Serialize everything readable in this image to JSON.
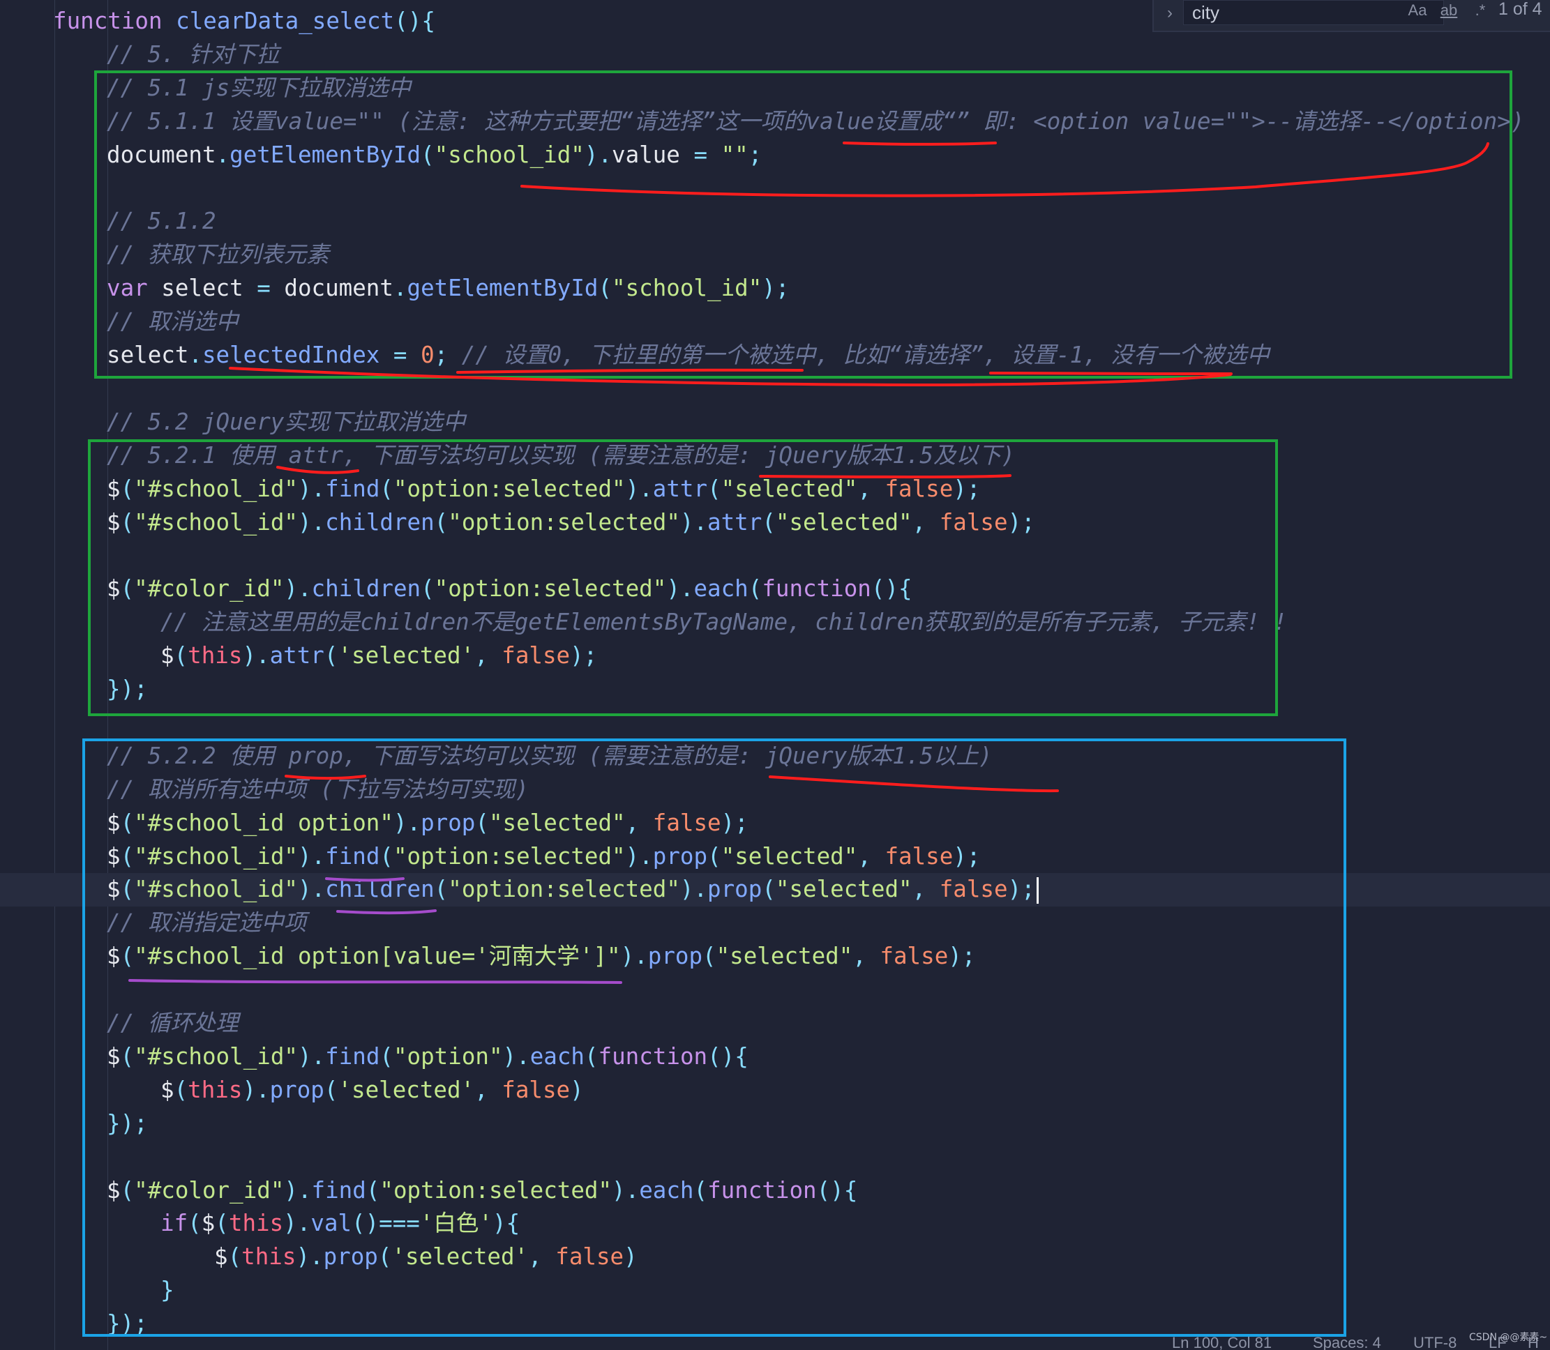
{
  "find_widget": {
    "search_value": "city",
    "match_case_label": "Aa",
    "match_word_label": "ab",
    "regex_label": ".*",
    "match_count": "1 of 4"
  },
  "status_bar": {
    "cursor_position": "Ln 100, Col 81",
    "indentation": "Spaces: 4",
    "encoding": "UTF-8",
    "line_ending": "LF",
    "extra": "H"
  },
  "watermark": "CSDN @@素素~",
  "code": [
    {
      "indent": 0,
      "tokens": [
        [
          "function",
          "keyword"
        ],
        [
          " ",
          "default"
        ],
        [
          "clearData_select",
          "function"
        ],
        [
          "()",
          "punct"
        ],
        [
          "{",
          "punct"
        ]
      ]
    },
    {
      "indent": 1,
      "tokens": [
        [
          "// 5. 针对下拉",
          "comment"
        ]
      ]
    },
    {
      "indent": 1,
      "tokens": [
        [
          "// 5.1 js实现下拉取消选中",
          "comment"
        ]
      ]
    },
    {
      "indent": 1,
      "tokens": [
        [
          "// 5.1.1 设置value=\"\" (注意: 这种方式要把“请选择”这一项的value设置成“” 即: <option value=\"\">--请选择--</option>)",
          "comment"
        ]
      ]
    },
    {
      "indent": 1,
      "tokens": [
        [
          "document",
          "default"
        ],
        [
          ".",
          "punct"
        ],
        [
          "getElementById",
          "function"
        ],
        [
          "(",
          "punct"
        ],
        [
          "\"school_id\"",
          "string"
        ],
        [
          ")",
          "punct"
        ],
        [
          ".",
          "punct"
        ],
        [
          "value",
          "default"
        ],
        [
          " = ",
          "punct"
        ],
        [
          "\"\"",
          "string"
        ],
        [
          ";",
          "punct"
        ]
      ]
    },
    {
      "indent": 1,
      "tokens": []
    },
    {
      "indent": 1,
      "tokens": [
        [
          "// 5.1.2",
          "comment"
        ]
      ]
    },
    {
      "indent": 1,
      "tokens": [
        [
          "// 获取下拉列表元素",
          "comment"
        ]
      ]
    },
    {
      "indent": 1,
      "tokens": [
        [
          "var",
          "keyword"
        ],
        [
          " select ",
          "default"
        ],
        [
          "=",
          "punct"
        ],
        [
          " document",
          "default"
        ],
        [
          ".",
          "punct"
        ],
        [
          "getElementById",
          "function"
        ],
        [
          "(",
          "punct"
        ],
        [
          "\"school_id\"",
          "string"
        ],
        [
          ")",
          "punct"
        ],
        [
          ";",
          "punct"
        ]
      ]
    },
    {
      "indent": 1,
      "tokens": [
        [
          "// 取消选中",
          "comment"
        ]
      ]
    },
    {
      "indent": 1,
      "tokens": [
        [
          "select",
          "default"
        ],
        [
          ".",
          "punct"
        ],
        [
          "selectedIndex",
          "function"
        ],
        [
          " = ",
          "punct"
        ],
        [
          "0",
          "number"
        ],
        [
          ";",
          "punct"
        ],
        [
          " // 设置0, 下拉里的第一个被选中, 比如“请选择”, 设置-1, 没有一个被选中",
          "comment"
        ]
      ]
    },
    {
      "indent": 1,
      "tokens": []
    },
    {
      "indent": 1,
      "tokens": [
        [
          "// 5.2 jQuery实现下拉取消选中",
          "comment"
        ]
      ]
    },
    {
      "indent": 1,
      "tokens": [
        [
          "// 5.2.1 使用 attr, 下面写法均可以实现 (需要注意的是: jQuery版本1.5及以下)",
          "comment"
        ]
      ]
    },
    {
      "indent": 1,
      "tokens": [
        [
          "$",
          "default"
        ],
        [
          "(",
          "punct"
        ],
        [
          "\"#school_id\"",
          "string"
        ],
        [
          ")",
          "punct"
        ],
        [
          ".",
          "punct"
        ],
        [
          "find",
          "function"
        ],
        [
          "(",
          "punct"
        ],
        [
          "\"option:selected\"",
          "string"
        ],
        [
          ")",
          "punct"
        ],
        [
          ".",
          "punct"
        ],
        [
          "attr",
          "function"
        ],
        [
          "(",
          "punct"
        ],
        [
          "\"selected\"",
          "string"
        ],
        [
          ", ",
          "punct"
        ],
        [
          "false",
          "const"
        ],
        [
          ");",
          "punct"
        ]
      ]
    },
    {
      "indent": 1,
      "tokens": [
        [
          "$",
          "default"
        ],
        [
          "(",
          "punct"
        ],
        [
          "\"#school_id\"",
          "string"
        ],
        [
          ")",
          "punct"
        ],
        [
          ".",
          "punct"
        ],
        [
          "children",
          "function"
        ],
        [
          "(",
          "punct"
        ],
        [
          "\"option:selected\"",
          "string"
        ],
        [
          ")",
          "punct"
        ],
        [
          ".",
          "punct"
        ],
        [
          "attr",
          "function"
        ],
        [
          "(",
          "punct"
        ],
        [
          "\"selected\"",
          "string"
        ],
        [
          ", ",
          "punct"
        ],
        [
          "false",
          "const"
        ],
        [
          ");",
          "punct"
        ]
      ]
    },
    {
      "indent": 1,
      "tokens": []
    },
    {
      "indent": 1,
      "tokens": [
        [
          "$",
          "default"
        ],
        [
          "(",
          "punct"
        ],
        [
          "\"#color_id\"",
          "string"
        ],
        [
          ")",
          "punct"
        ],
        [
          ".",
          "punct"
        ],
        [
          "children",
          "function"
        ],
        [
          "(",
          "punct"
        ],
        [
          "\"option:selected\"",
          "string"
        ],
        [
          ")",
          "punct"
        ],
        [
          ".",
          "punct"
        ],
        [
          "each",
          "function"
        ],
        [
          "(",
          "punct"
        ],
        [
          "function",
          "keyword"
        ],
        [
          "(){",
          "punct"
        ]
      ]
    },
    {
      "indent": 2,
      "tokens": [
        [
          "// 注意这里用的是children不是getElementsByTagName, children获取到的是所有子元素, 子元素! !",
          "comment"
        ]
      ]
    },
    {
      "indent": 2,
      "tokens": [
        [
          "$",
          "default"
        ],
        [
          "(",
          "punct"
        ],
        [
          "this",
          "this"
        ],
        [
          ")",
          "punct"
        ],
        [
          ".",
          "punct"
        ],
        [
          "attr",
          "function"
        ],
        [
          "(",
          "punct"
        ],
        [
          "'selected'",
          "string"
        ],
        [
          ", ",
          "punct"
        ],
        [
          "false",
          "const"
        ],
        [
          ");",
          "punct"
        ]
      ]
    },
    {
      "indent": 1,
      "tokens": [
        [
          "});",
          "punct"
        ]
      ]
    },
    {
      "indent": 1,
      "tokens": []
    },
    {
      "indent": 1,
      "tokens": [
        [
          "// 5.2.2 使用 prop, 下面写法均可以实现 (需要注意的是: jQuery版本1.5以上)",
          "comment"
        ]
      ]
    },
    {
      "indent": 1,
      "tokens": [
        [
          "// 取消所有选中项 (下拉写法均可实现)",
          "comment"
        ]
      ]
    },
    {
      "indent": 1,
      "tokens": [
        [
          "$",
          "default"
        ],
        [
          "(",
          "punct"
        ],
        [
          "\"#school_id option\"",
          "string"
        ],
        [
          ")",
          "punct"
        ],
        [
          ".",
          "punct"
        ],
        [
          "prop",
          "function"
        ],
        [
          "(",
          "punct"
        ],
        [
          "\"selected\"",
          "string"
        ],
        [
          ", ",
          "punct"
        ],
        [
          "false",
          "const"
        ],
        [
          ");",
          "punct"
        ]
      ]
    },
    {
      "indent": 1,
      "tokens": [
        [
          "$",
          "default"
        ],
        [
          "(",
          "punct"
        ],
        [
          "\"#school_id\"",
          "string"
        ],
        [
          ")",
          "punct"
        ],
        [
          ".",
          "punct"
        ],
        [
          "find",
          "function"
        ],
        [
          "(",
          "punct"
        ],
        [
          "\"option:selected\"",
          "string"
        ],
        [
          ")",
          "punct"
        ],
        [
          ".",
          "punct"
        ],
        [
          "prop",
          "function"
        ],
        [
          "(",
          "punct"
        ],
        [
          "\"selected\"",
          "string"
        ],
        [
          ", ",
          "punct"
        ],
        [
          "false",
          "const"
        ],
        [
          ");",
          "punct"
        ]
      ]
    },
    {
      "indent": 1,
      "tokens": [
        [
          "$",
          "default"
        ],
        [
          "(",
          "punct"
        ],
        [
          "\"#school_id\"",
          "string"
        ],
        [
          ")",
          "punct"
        ],
        [
          ".",
          "punct"
        ],
        [
          "children",
          "function"
        ],
        [
          "(",
          "punct"
        ],
        [
          "\"option:selected\"",
          "string"
        ],
        [
          ")",
          "punct"
        ],
        [
          ".",
          "punct"
        ],
        [
          "prop",
          "function"
        ],
        [
          "(",
          "punct"
        ],
        [
          "\"selected\"",
          "string"
        ],
        [
          ", ",
          "punct"
        ],
        [
          "false",
          "const"
        ],
        [
          ");",
          "punct"
        ]
      ],
      "current": true
    },
    {
      "indent": 1,
      "tokens": [
        [
          "// 取消指定选中项",
          "comment"
        ]
      ]
    },
    {
      "indent": 1,
      "tokens": [
        [
          "$",
          "default"
        ],
        [
          "(",
          "punct"
        ],
        [
          "\"#school_id option[value='河南大学']\"",
          "string"
        ],
        [
          ")",
          "punct"
        ],
        [
          ".",
          "punct"
        ],
        [
          "prop",
          "function"
        ],
        [
          "(",
          "punct"
        ],
        [
          "\"selected\"",
          "string"
        ],
        [
          ", ",
          "punct"
        ],
        [
          "false",
          "const"
        ],
        [
          ");",
          "punct"
        ]
      ]
    },
    {
      "indent": 1,
      "tokens": []
    },
    {
      "indent": 1,
      "tokens": [
        [
          "// 循环处理",
          "comment"
        ]
      ]
    },
    {
      "indent": 1,
      "tokens": [
        [
          "$",
          "default"
        ],
        [
          "(",
          "punct"
        ],
        [
          "\"#school_id\"",
          "string"
        ],
        [
          ")",
          "punct"
        ],
        [
          ".",
          "punct"
        ],
        [
          "find",
          "function"
        ],
        [
          "(",
          "punct"
        ],
        [
          "\"option\"",
          "string"
        ],
        [
          ")",
          "punct"
        ],
        [
          ".",
          "punct"
        ],
        [
          "each",
          "function"
        ],
        [
          "(",
          "punct"
        ],
        [
          "function",
          "keyword"
        ],
        [
          "(){",
          "punct"
        ]
      ]
    },
    {
      "indent": 2,
      "tokens": [
        [
          "$",
          "default"
        ],
        [
          "(",
          "punct"
        ],
        [
          "this",
          "this"
        ],
        [
          ")",
          "punct"
        ],
        [
          ".",
          "punct"
        ],
        [
          "prop",
          "function"
        ],
        [
          "(",
          "punct"
        ],
        [
          "'selected'",
          "string"
        ],
        [
          ", ",
          "punct"
        ],
        [
          "false",
          "const"
        ],
        [
          ")",
          "punct"
        ]
      ]
    },
    {
      "indent": 1,
      "tokens": [
        [
          "});",
          "punct"
        ]
      ]
    },
    {
      "indent": 1,
      "tokens": []
    },
    {
      "indent": 1,
      "tokens": [
        [
          "$",
          "default"
        ],
        [
          "(",
          "punct"
        ],
        [
          "\"#color_id\"",
          "string"
        ],
        [
          ")",
          "punct"
        ],
        [
          ".",
          "punct"
        ],
        [
          "find",
          "function"
        ],
        [
          "(",
          "punct"
        ],
        [
          "\"option:selected\"",
          "string"
        ],
        [
          ")",
          "punct"
        ],
        [
          ".",
          "punct"
        ],
        [
          "each",
          "function"
        ],
        [
          "(",
          "punct"
        ],
        [
          "function",
          "keyword"
        ],
        [
          "(){",
          "punct"
        ]
      ]
    },
    {
      "indent": 2,
      "tokens": [
        [
          "if",
          "keyword"
        ],
        [
          "(",
          "punct"
        ],
        [
          "$",
          "default"
        ],
        [
          "(",
          "punct"
        ],
        [
          "this",
          "this"
        ],
        [
          ")",
          "punct"
        ],
        [
          ".",
          "punct"
        ],
        [
          "val",
          "function"
        ],
        [
          "()===",
          "punct"
        ],
        [
          "'白色'",
          "string"
        ],
        [
          "){",
          "punct"
        ]
      ]
    },
    {
      "indent": 3,
      "tokens": [
        [
          "$",
          "default"
        ],
        [
          "(",
          "punct"
        ],
        [
          "this",
          "this"
        ],
        [
          ")",
          "punct"
        ],
        [
          ".",
          "punct"
        ],
        [
          "prop",
          "function"
        ],
        [
          "(",
          "punct"
        ],
        [
          "'selected'",
          "string"
        ],
        [
          ", ",
          "punct"
        ],
        [
          "false",
          "const"
        ],
        [
          ")",
          "punct"
        ]
      ]
    },
    {
      "indent": 2,
      "tokens": [
        [
          "}",
          "punct"
        ]
      ]
    },
    {
      "indent": 1,
      "tokens": [
        [
          "});",
          "punct"
        ]
      ]
    }
  ]
}
